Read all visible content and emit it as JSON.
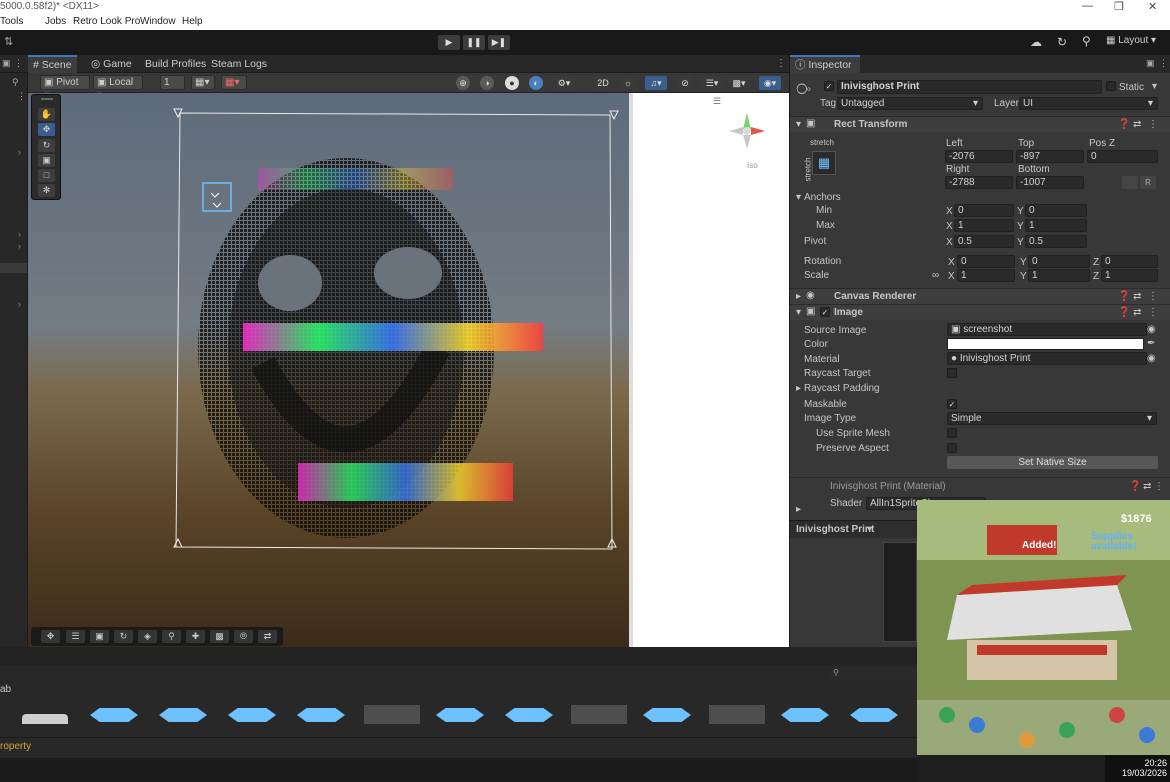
{
  "window": {
    "title_fragment": "5000.0.58f2)* <DX11>"
  },
  "menu": [
    "Tools",
    "Jobs",
    "Retro Look Pro",
    "Window",
    "Help"
  ],
  "tabs": {
    "scene": "Scene",
    "game": "Game",
    "build_profiles": "Build Profiles",
    "steam_logs": "Steam Logs",
    "inspector": "Inspector"
  },
  "scene_toolbar": {
    "pivot": "Pivot",
    "local": "Local",
    "snap": "1"
  },
  "toolbar": {
    "layout": "Layout"
  },
  "gizmo": {
    "persp": "Iso"
  },
  "inspector": {
    "object_name": "Inivisghost Print",
    "static_label": "Static",
    "tag_label": "Tag",
    "tag_value": "Untagged",
    "layer_label": "Layer",
    "layer_value": "UI",
    "rect_transform": "Rect Transform",
    "stretch": "stretch",
    "left_label": "Left",
    "top_label": "Top",
    "posz_label": "Pos Z",
    "left": "-2076",
    "top": "-897",
    "posz": "0",
    "right_label": "Right",
    "bottom_label": "Bottom",
    "right": "-2788",
    "bottom": "-1007",
    "anchors": "Anchors",
    "min_label": "Min",
    "max_label": "Max",
    "min_x": "0",
    "min_y": "0",
    "max_x": "1",
    "max_y": "1",
    "pivot_label": "Pivot",
    "pivot_x": "0.5",
    "pivot_y": "0.5",
    "rotation_label": "Rotation",
    "rot_x": "0",
    "rot_y": "0",
    "rot_z": "0",
    "scale_label": "Scale",
    "scale_x": "1",
    "scale_y": "1",
    "scale_z": "1",
    "x": "X",
    "y": "Y",
    "z": "Z",
    "canvas_renderer": "Canvas Renderer",
    "image": "Image",
    "source_image_label": "Source Image",
    "source_image": "screenshot",
    "color_label": "Color",
    "material_label": "Material",
    "material": "Inivisghost Print",
    "raycast_target": "Raycast Target",
    "raycast_padding": "Raycast Padding",
    "maskable": "Maskable",
    "image_type_label": "Image Type",
    "image_type": "Simple",
    "use_sprite_mesh": "Use Sprite Mesh",
    "preserve_aspect": "Preserve Aspect",
    "set_native_size": "Set Native Size",
    "material_header": "Inivisghost Print (Material)",
    "shader_label": "Shader",
    "shader": "AllIn1SpriteSh",
    "preview_label": "Inivisghost Print"
  },
  "bottom": {
    "tab_label": "ab",
    "property_label": "roperty"
  },
  "game_overlay": {
    "money": "$1876",
    "banner": "Added!",
    "supplies": "Supplies available!"
  },
  "clock": {
    "time": "20:26",
    "date": "19/03/2026"
  },
  "colors": {
    "accent": "#3a79bb",
    "diamond": "#6ec1ff"
  }
}
